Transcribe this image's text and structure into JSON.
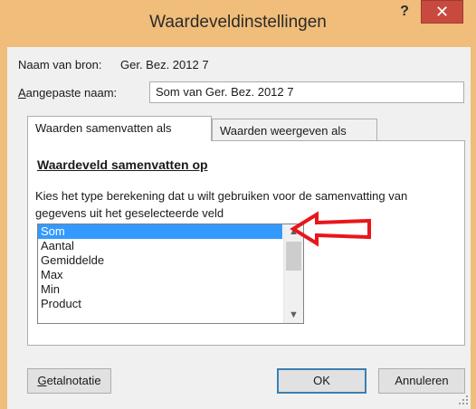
{
  "window": {
    "title": "Waardeveldinstellingen",
    "help_label": "?",
    "close_label": "✕",
    "frame_color": "#f0bd7a",
    "close_color": "#c84a3e"
  },
  "source": {
    "label": "Naam van bron:",
    "value": "Ger. Bez. 2012 7"
  },
  "custom_name": {
    "label_first": "A",
    "label_rest": "angepaste naam:",
    "value": "Som van Ger. Bez. 2012 7"
  },
  "tabs": [
    {
      "label": "Waarden samenvatten als",
      "active": true
    },
    {
      "label": "Waarden weergeven als",
      "active": false
    }
  ],
  "panel": {
    "section_title": "Waardeveld samenvatten op",
    "description": "Kies het type berekening dat u wilt gebruiken voor de samenvatting van gegevens uit het geselecteerde veld",
    "list_items": [
      "Som",
      "Aantal",
      "Gemiddelde",
      "Max",
      "Min",
      "Product"
    ],
    "selected_index": 0,
    "selection_color": "#3399ff",
    "scroll_up_icon": "chevron-up-icon",
    "scroll_down_icon": "chevron-down-icon"
  },
  "annotation": {
    "icon": "red-arrow-icon",
    "color": "#e8161b"
  },
  "buttons": {
    "format_first": "G",
    "format_rest": "etalnotatie",
    "ok": "OK",
    "cancel": "Annuleren"
  }
}
